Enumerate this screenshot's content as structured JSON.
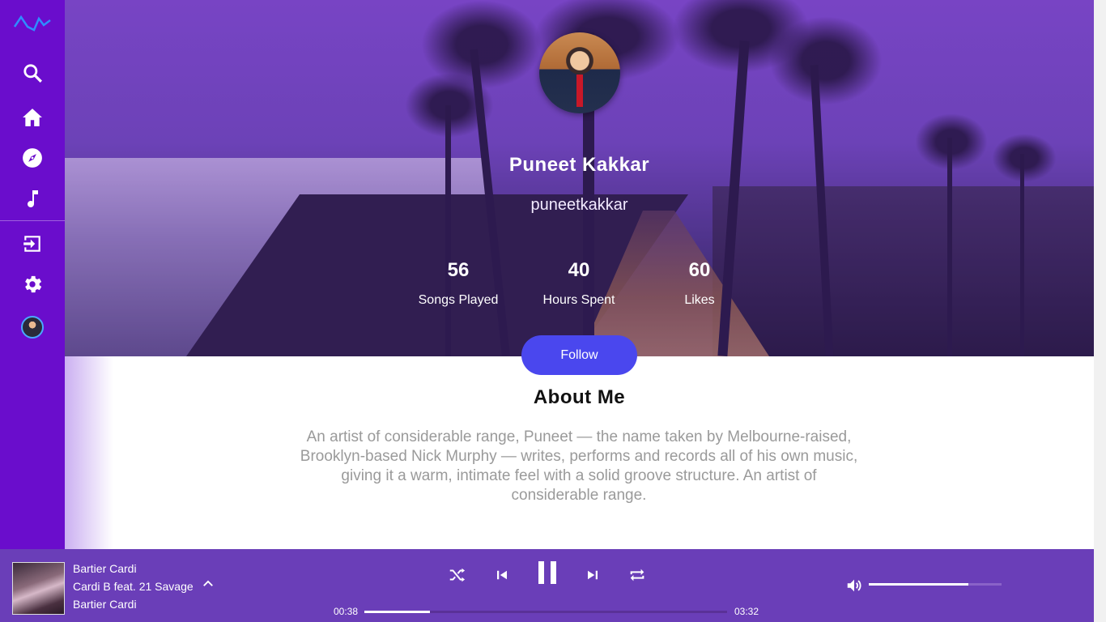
{
  "profile": {
    "name": "Puneet Kakkar",
    "handle": "puneetkakkar",
    "stats": [
      {
        "value": "56",
        "label": "Songs Played"
      },
      {
        "value": "40",
        "label": "Hours Spent"
      },
      {
        "value": "60",
        "label": "Likes"
      }
    ],
    "follow_label": "Follow"
  },
  "about": {
    "title": "About Me",
    "text": "An artist of considerable range, Puneet — the name taken by Melbourne-raised, Brooklyn-based Nick Murphy — writes, performs and records all of his own music, giving it a warm, intimate feel with a solid groove structure. An artist of considerable range."
  },
  "sidebar": {
    "icons": [
      "logo-wave-icon",
      "search-icon",
      "home-icon",
      "compass-icon",
      "music-note-icon",
      "login-icon",
      "settings-icon",
      "avatar"
    ]
  },
  "player": {
    "track_title": "Bartier Cardi",
    "artist": "Cardi B feat. 21 Savage",
    "album": "Bartier Cardi",
    "elapsed": "00:38",
    "duration": "03:32",
    "progress_fraction": 0.18,
    "volume_fraction": 0.75
  },
  "colors": {
    "sidebar": "#6a0dcc",
    "player": "#6a3eb8",
    "follow_button": "#4a47ee"
  }
}
